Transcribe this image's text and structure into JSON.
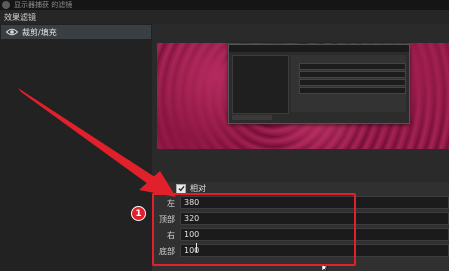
{
  "window": {
    "title": "显示器捕获 的滤镜"
  },
  "filters_panel": {
    "section_title": "效果滤镜",
    "items": [
      {
        "label": "裁剪/填充",
        "visible": true
      }
    ]
  },
  "properties": {
    "relative_checkbox": {
      "label": "相对",
      "checked": true
    },
    "fields": [
      {
        "label": "左",
        "value": "380"
      },
      {
        "label": "顶部",
        "value": "320"
      },
      {
        "label": "右",
        "value": "100"
      },
      {
        "label": "底部",
        "value": "100"
      }
    ]
  },
  "annotation": {
    "badge_number": "1",
    "color": "#e0202a"
  },
  "icons": [
    "eye-icon",
    "checkmark-icon",
    "annotation-arrow-icon",
    "mouse-cursor-icon"
  ]
}
